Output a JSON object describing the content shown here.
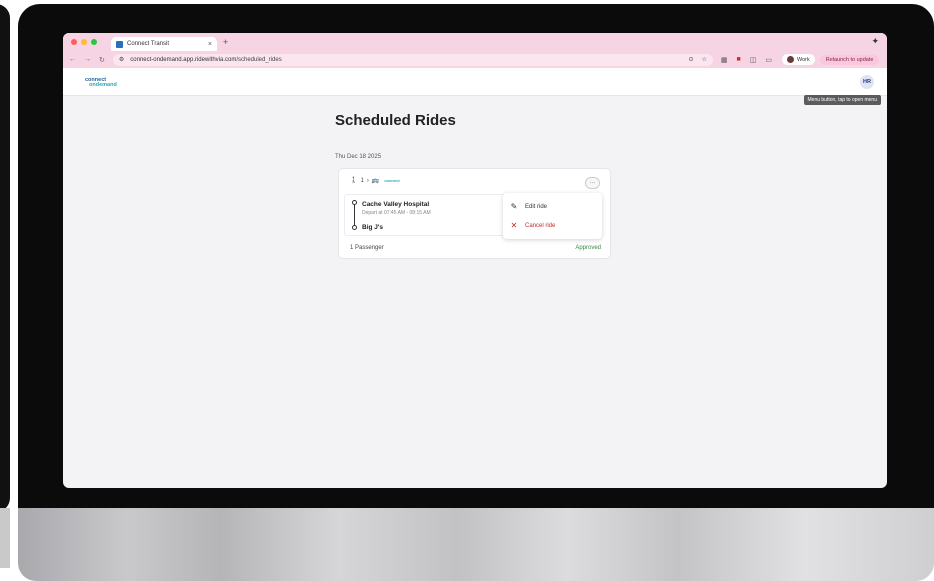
{
  "browser": {
    "tab_title": "Connect Transit",
    "tab_close": "×",
    "new_tab": "+",
    "url_prefix": "connect-ondemand.app.ridewithvia.com",
    "url_path": "/scheduled_rides",
    "profile_label": "Work",
    "relaunch_label": "Relaunch to update"
  },
  "app": {
    "logo_top": "connect",
    "logo_bottom": "ondemand",
    "avatar_initials": "HR",
    "tooltip": "Menu button, tap to open menu"
  },
  "page": {
    "title": "Scheduled Rides",
    "date": "Thu Dec 18 2025"
  },
  "ride": {
    "walk_count": "1",
    "origin": "Cache Valley Hospital",
    "depart": "Depart at 07:45 AM - 08:15 AM",
    "destination": "Big J's",
    "passengers": "1 Passenger",
    "status": "Approved",
    "more_label": "···"
  },
  "menu": {
    "edit_label": "Edit ride",
    "cancel_label": "Cancel ride"
  },
  "colors": {
    "accent": "#1b5e9e",
    "approved": "#3b8b4a",
    "cancel": "#c62828",
    "browser_chrome": "#f6d4e3"
  },
  "icons": [
    "walk-icon",
    "bus-icon",
    "pencil-icon",
    "close-icon",
    "star-icon",
    "location-icon"
  ]
}
